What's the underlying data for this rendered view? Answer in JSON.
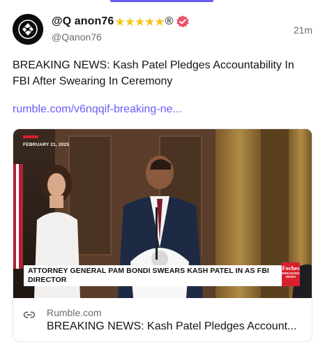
{
  "post": {
    "display_name": "@Q anon76",
    "rating_stars": "★★★★★",
    "registered_mark": "®",
    "handle": "@Qanon76",
    "timestamp": "21m",
    "text": "BREAKING NEWS: Kash Patel Pledges Accountability In FBI After Swearing In Ceremony",
    "link_text": "rumble.com/v6nqqif-breaking-ne...",
    "verified_badge_color": "#f0526b",
    "accent_color": "#6b5cf6"
  },
  "card": {
    "thumbnail": {
      "date_tag": "FEBRUARY 21, 2025",
      "caption": "ATTORNEY GENERAL PAM BONDI SWEARS KASH PATEL IN AS FBI DIRECTOR",
      "badge_logo": "Forbes",
      "badge_sub": "BREAKING NEWS"
    },
    "domain": "Rumble.com",
    "title": "BREAKING NEWS: Kash Patel Pledges Account..."
  },
  "icons": {
    "link": "link-icon",
    "verified": "verified-badge-icon",
    "avatar": "avatar-image"
  }
}
